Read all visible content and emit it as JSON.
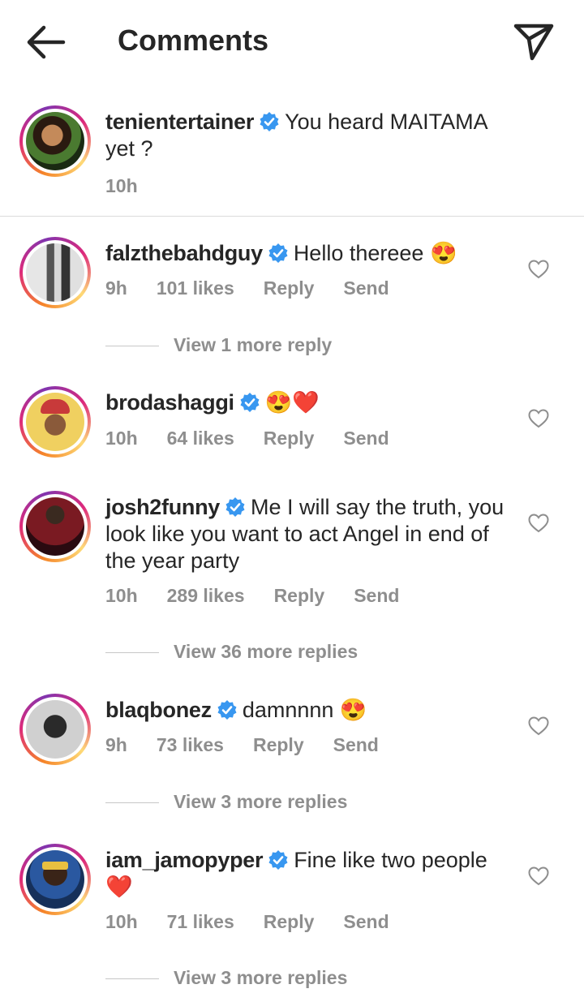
{
  "header": {
    "title": "Comments"
  },
  "caption": {
    "username": "tenientertainer",
    "text": "You heard MAITAMA yet ?",
    "time": "10h"
  },
  "comments": [
    {
      "username": "falzthebahdguy",
      "text": "Hello thereee",
      "emoji": "😍",
      "time": "9h",
      "likes": "101 likes",
      "reply": "Reply",
      "send": "Send",
      "view_more": "View 1 more reply"
    },
    {
      "username": "brodashaggi",
      "text": "",
      "emoji": "😍❤️",
      "time": "10h",
      "likes": "64 likes",
      "reply": "Reply",
      "send": "Send"
    },
    {
      "username": "josh2funny",
      "text": "Me I will say the truth, you look like you want to act Angel in end of the year party",
      "emoji": "",
      "time": "10h",
      "likes": "289 likes",
      "reply": "Reply",
      "send": "Send",
      "view_more": "View 36 more replies"
    },
    {
      "username": "blaqbonez",
      "text": "damnnnn",
      "emoji": "😍",
      "time": "9h",
      "likes": "73 likes",
      "reply": "Reply",
      "send": "Send",
      "view_more": "View 3 more replies"
    },
    {
      "username": "iam_jamopyper",
      "text": "Fine like two people",
      "emoji": "❤️",
      "time": "10h",
      "likes": "71 likes",
      "reply": "Reply",
      "send": "Send",
      "view_more": "View 3 more replies"
    }
  ],
  "icons": {
    "back": "arrow-left-icon",
    "send": "paper-plane-icon",
    "verified": "verified-badge-icon",
    "like": "heart-outline-icon"
  },
  "colors": {
    "verified": "#3897f0",
    "secondary_text": "#8e8e8e",
    "divider": "#dbdbdb"
  }
}
